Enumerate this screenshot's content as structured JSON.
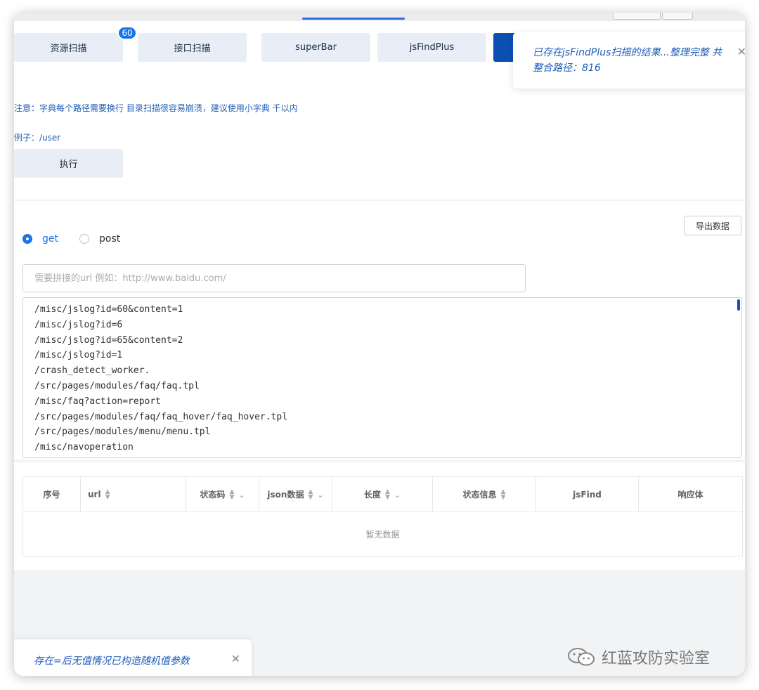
{
  "tabs": [
    {
      "label": "资源扫描"
    },
    {
      "label": "接口扫描"
    },
    {
      "label": "superBar"
    },
    {
      "label": "jsFindPlus"
    },
    {
      "label": ""
    }
  ],
  "badge_count": "60",
  "toast_top": {
    "line1": "已存在jsFindPlus扫描的结果...整理完整 共",
    "line2": "整合路径：816"
  },
  "notice": "注意：字典每个路径需要换行 目录扫描很容易崩溃，建议使用小字典 千以内",
  "example": "例子：/user",
  "execute_label": "执行",
  "export_label": "导出数据",
  "method": {
    "options": [
      "get",
      "post"
    ],
    "selected": "get"
  },
  "url_input": {
    "value": "",
    "placeholder": "需要拼接的url 例如：http://www.baidu.com/"
  },
  "paths": [
    "/misc/jslog?id=60&content=1",
    "/misc/jslog?id=6",
    "/misc/jslog?id=65&content=2",
    "/misc/jslog?id=1",
    "/crash_detect_worker.",
    "/src/pages/modules/faq/faq.tpl",
    "/misc/faq?action=report",
    "/src/pages/modules/faq/faq_hover/faq_hover.tpl",
    "/src/pages/modules/menu/menu.tpl",
    "/misc/navoperation"
  ],
  "table": {
    "columns": [
      "序号",
      "url",
      "状态码",
      "json数据",
      "长度",
      "状态信息",
      "jsFind",
      "响应体"
    ],
    "empty_text": "暂无数据"
  },
  "toast_bottom": {
    "message": "存在=后无值情况已构造随机值参数"
  },
  "watermark": "红蓝攻防实验室",
  "colors": {
    "accent": "#1a73e8",
    "primary_dark": "#0b4fb3",
    "notice_text": "#1f5db8"
  },
  "icons": [
    "close-icon",
    "sort-icon",
    "filter-chevron-icon",
    "wechat-icon"
  ]
}
